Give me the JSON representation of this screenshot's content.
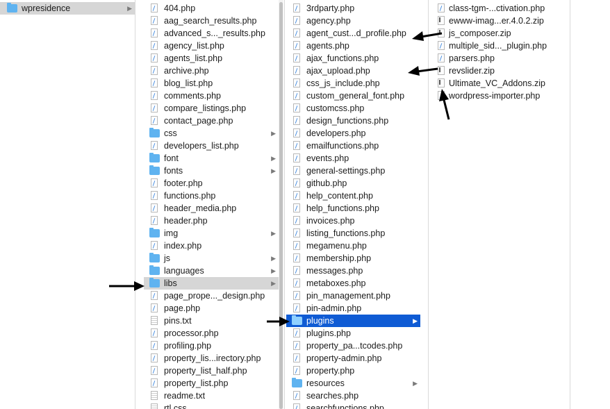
{
  "columns": [
    {
      "name": "column-1",
      "items": [
        {
          "name": "wpresidence",
          "type": "folder",
          "selected": "gray"
        }
      ]
    },
    {
      "name": "column-2",
      "items": [
        {
          "name": "404.php",
          "type": "php"
        },
        {
          "name": "aag_search_results.php",
          "type": "php"
        },
        {
          "name": "advanced_s..._results.php",
          "type": "php"
        },
        {
          "name": "agency_list.php",
          "type": "php"
        },
        {
          "name": "agents_list.php",
          "type": "php"
        },
        {
          "name": "archive.php",
          "type": "php"
        },
        {
          "name": "blog_list.php",
          "type": "php"
        },
        {
          "name": "comments.php",
          "type": "php"
        },
        {
          "name": "compare_listings.php",
          "type": "php"
        },
        {
          "name": "contact_page.php",
          "type": "php"
        },
        {
          "name": "css",
          "type": "folder"
        },
        {
          "name": "developers_list.php",
          "type": "php"
        },
        {
          "name": "font",
          "type": "folder"
        },
        {
          "name": "fonts",
          "type": "folder"
        },
        {
          "name": "footer.php",
          "type": "php"
        },
        {
          "name": "functions.php",
          "type": "php"
        },
        {
          "name": "header_media.php",
          "type": "php"
        },
        {
          "name": "header.php",
          "type": "php"
        },
        {
          "name": "img",
          "type": "folder"
        },
        {
          "name": "index.php",
          "type": "php"
        },
        {
          "name": "js",
          "type": "folder"
        },
        {
          "name": "languages",
          "type": "folder"
        },
        {
          "name": "libs",
          "type": "folder",
          "selected": "gray"
        },
        {
          "name": "page_prope..._design.php",
          "type": "php"
        },
        {
          "name": "page.php",
          "type": "php"
        },
        {
          "name": "pins.txt",
          "type": "txt"
        },
        {
          "name": "processor.php",
          "type": "php"
        },
        {
          "name": "profiling.php",
          "type": "php"
        },
        {
          "name": "property_lis...irectory.php",
          "type": "php"
        },
        {
          "name": "property_list_half.php",
          "type": "php"
        },
        {
          "name": "property_list.php",
          "type": "php"
        },
        {
          "name": "readme.txt",
          "type": "txt"
        },
        {
          "name": "rtl.css",
          "type": "txt"
        }
      ]
    },
    {
      "name": "column-3",
      "items": [
        {
          "name": "3rdparty.php",
          "type": "php"
        },
        {
          "name": "agency.php",
          "type": "php"
        },
        {
          "name": "agent_cust...d_profile.php",
          "type": "php"
        },
        {
          "name": "agents.php",
          "type": "php"
        },
        {
          "name": "ajax_functions.php",
          "type": "php"
        },
        {
          "name": "ajax_upload.php",
          "type": "php"
        },
        {
          "name": "css_js_include.php",
          "type": "php"
        },
        {
          "name": "custom_general_font.php",
          "type": "php"
        },
        {
          "name": "customcss.php",
          "type": "php"
        },
        {
          "name": "design_functions.php",
          "type": "php"
        },
        {
          "name": "developers.php",
          "type": "php"
        },
        {
          "name": "emailfunctions.php",
          "type": "php"
        },
        {
          "name": "events.php",
          "type": "php"
        },
        {
          "name": "general-settings.php",
          "type": "php"
        },
        {
          "name": "github.php",
          "type": "php"
        },
        {
          "name": "help_content.php",
          "type": "php"
        },
        {
          "name": "help_functions.php",
          "type": "php"
        },
        {
          "name": "invoices.php",
          "type": "php"
        },
        {
          "name": "listing_functions.php",
          "type": "php"
        },
        {
          "name": "megamenu.php",
          "type": "php"
        },
        {
          "name": "membership.php",
          "type": "php"
        },
        {
          "name": "messages.php",
          "type": "php"
        },
        {
          "name": "metaboxes.php",
          "type": "php"
        },
        {
          "name": "pin_management.php",
          "type": "php"
        },
        {
          "name": "pin-admin.php",
          "type": "php"
        },
        {
          "name": "plugins",
          "type": "folder",
          "selected": "blue"
        },
        {
          "name": "plugins.php",
          "type": "php"
        },
        {
          "name": "property_pa...tcodes.php",
          "type": "php"
        },
        {
          "name": "property-admin.php",
          "type": "php"
        },
        {
          "name": "property.php",
          "type": "php"
        },
        {
          "name": "resources",
          "type": "folder"
        },
        {
          "name": "searches.php",
          "type": "php"
        },
        {
          "name": "searchfunctions.php",
          "type": "php"
        }
      ]
    },
    {
      "name": "column-4",
      "items": [
        {
          "name": "class-tgm-...ctivation.php",
          "type": "php"
        },
        {
          "name": "ewww-imag...er.4.0.2.zip",
          "type": "zip"
        },
        {
          "name": "js_composer.zip",
          "type": "zip"
        },
        {
          "name": "multiple_sid..._plugin.php",
          "type": "php"
        },
        {
          "name": "parsers.php",
          "type": "php"
        },
        {
          "name": "revslider.zip",
          "type": "zip"
        },
        {
          "name": "Ultimate_VC_Addons.zip",
          "type": "zip"
        },
        {
          "name": "wordpress-importer.php",
          "type": "php"
        }
      ]
    }
  ],
  "colors": {
    "selection_gray": "#d6d6d6",
    "selection_blue": "#0f5bd4",
    "folder": "#5fb3f0",
    "arrow": "#000000"
  }
}
